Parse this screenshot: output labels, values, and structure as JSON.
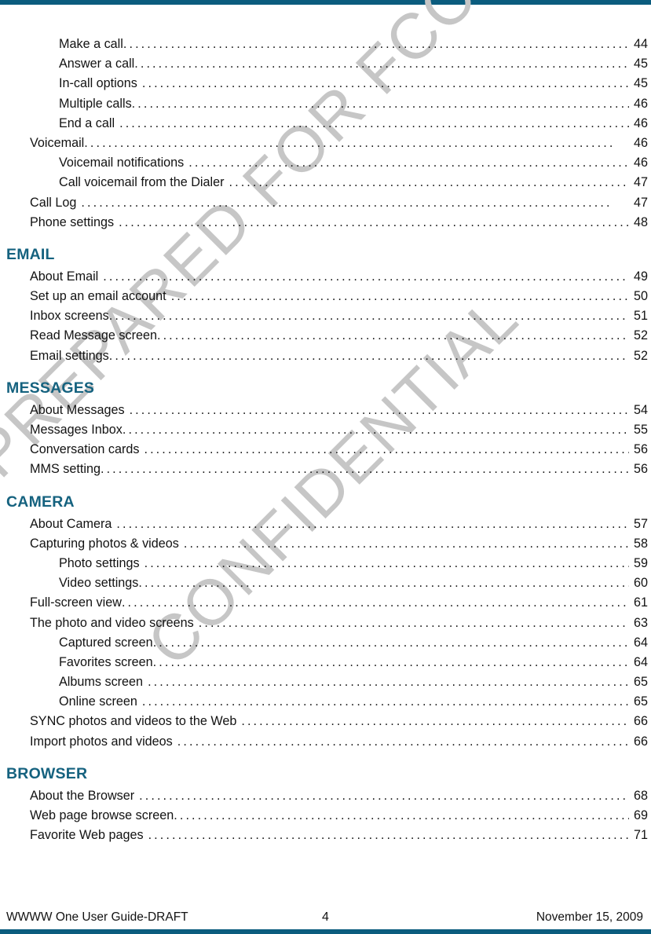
{
  "document": {
    "type": "table-of-contents",
    "top_rule_color": "#0b5c7e",
    "bottom_rule_color": "#0b5c7e",
    "heading_color": "#15627f",
    "watermark_color": "#c6c6c6"
  },
  "watermark": {
    "line1": "PREPARED FOR FCC CERTIFICATION",
    "line2": "CONFIDENTIAL"
  },
  "toc": {
    "groups": [
      {
        "heading": null,
        "entries": [
          {
            "title": "Make a call",
            "page": "44",
            "level": 2,
            "leader_gap": "tight"
          },
          {
            "title": "Answer a call",
            "page": "45",
            "level": 2,
            "leader_gap": "tight"
          },
          {
            "title": "In-call options",
            "page": "45",
            "level": 2,
            "leader_gap": "loose"
          },
          {
            "title": "Multiple calls",
            "page": "46",
            "level": 2,
            "leader_gap": "tight"
          },
          {
            "title": "End a call",
            "page": "46",
            "level": 2,
            "leader_gap": "loose"
          },
          {
            "title": "Voicemail",
            "page": "46",
            "level": 1,
            "leader_gap": "tight"
          },
          {
            "title": "Voicemail notifications",
            "page": "46",
            "level": 2,
            "leader_gap": "loose"
          },
          {
            "title": "Call voicemail from the Dialer",
            "page": "47",
            "level": 2,
            "leader_gap": "loose"
          },
          {
            "title": "Call Log",
            "page": "47",
            "level": 1,
            "leader_gap": "loose"
          },
          {
            "title": "Phone settings",
            "page": "48",
            "level": 1,
            "leader_gap": "loose"
          }
        ]
      },
      {
        "heading": "EMAIL",
        "entries": [
          {
            "title": "About Email",
            "page": "49",
            "level": 1,
            "leader_gap": "loose"
          },
          {
            "title": "Set up an email account",
            "page": "50",
            "level": 1,
            "leader_gap": "loose"
          },
          {
            "title": "Inbox screens",
            "page": "51",
            "level": 1,
            "leader_gap": "tight"
          },
          {
            "title": "Read Message screen",
            "page": "52",
            "level": 1,
            "leader_gap": "tight"
          },
          {
            "title": "Email settings",
            "page": "52",
            "level": 1,
            "leader_gap": "tight"
          }
        ]
      },
      {
        "heading": "MESSAGES",
        "entries": [
          {
            "title": "About Messages",
            "page": "54",
            "level": 1,
            "leader_gap": "loose"
          },
          {
            "title": "Messages Inbox",
            "page": "55",
            "level": 1,
            "leader_gap": "tight"
          },
          {
            "title": "Conversation cards",
            "page": "56",
            "level": 1,
            "leader_gap": "loose"
          },
          {
            "title": "MMS setting",
            "page": "56",
            "level": 1,
            "leader_gap": "tight"
          }
        ]
      },
      {
        "heading": "CAMERA",
        "entries": [
          {
            "title": "About Camera",
            "page": "57",
            "level": 1,
            "leader_gap": "loose"
          },
          {
            "title": "Capturing photos & videos",
            "page": "58",
            "level": 1,
            "leader_gap": "loose"
          },
          {
            "title": "Photo settings",
            "page": "59",
            "level": 2,
            "leader_gap": "loose"
          },
          {
            "title": "Video settings",
            "page": "60",
            "level": 2,
            "leader_gap": "tight"
          },
          {
            "title": "Full-screen view",
            "page": "61",
            "level": 1,
            "leader_gap": "tight"
          },
          {
            "title": "The photo and video screens",
            "page": "63",
            "level": 1,
            "leader_gap": "loose"
          },
          {
            "title": "Captured screen",
            "page": "64",
            "level": 2,
            "leader_gap": "tight"
          },
          {
            "title": "Favorites screen",
            "page": "64",
            "level": 2,
            "leader_gap": "tight"
          },
          {
            "title": "Albums screen",
            "page": "65",
            "level": 2,
            "leader_gap": "loose"
          },
          {
            "title": "Online screen",
            "page": "65",
            "level": 2,
            "leader_gap": "loose"
          },
          {
            "title": "SYNC photos and videos to the Web",
            "page": "66",
            "level": 1,
            "leader_gap": "loose"
          },
          {
            "title": "Import photos and videos",
            "page": "66",
            "level": 1,
            "leader_gap": "loose"
          }
        ]
      },
      {
        "heading": "BROWSER",
        "entries": [
          {
            "title": "About the Browser",
            "page": "68",
            "level": 1,
            "leader_gap": "loose"
          },
          {
            "title": "Web page browse screen",
            "page": "69",
            "level": 1,
            "leader_gap": "tight"
          },
          {
            "title": "Favorite Web pages",
            "page": "71",
            "level": 1,
            "leader_gap": "loose"
          }
        ]
      }
    ]
  },
  "footer": {
    "left": "WWWW One User Guide-DRAFT",
    "page_number": "4",
    "right": "November 15, 2009"
  }
}
